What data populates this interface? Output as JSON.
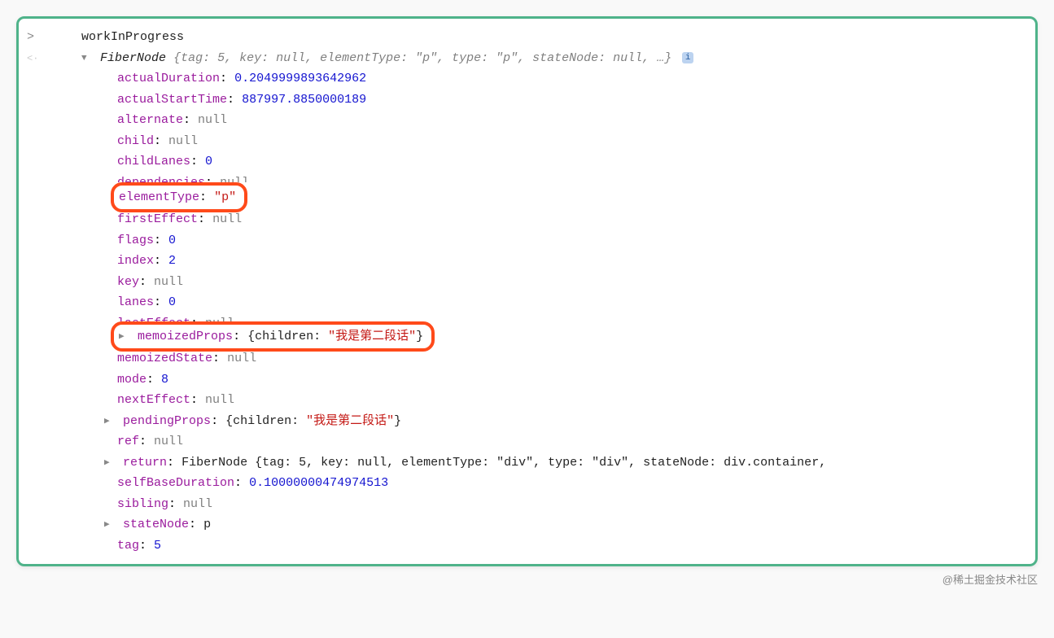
{
  "prompt": "workInProgress",
  "summary": {
    "typeName": "FiberNode",
    "open": "{",
    "inside": "tag: 5, key: null, elementType: \"p\", type: \"p\", stateNode: null, …",
    "close": "}",
    "info": "i"
  },
  "props": {
    "actualDuration_k": "actualDuration",
    "actualDuration_v": "0.2049999893642962",
    "actualStartTime_k": "actualStartTime",
    "actualStartTime_v": "887997.8850000189",
    "alternate_k": "alternate",
    "alternate_v": "null",
    "child_k": "child",
    "child_v": "null",
    "childLanes_k": "childLanes",
    "childLanes_v": "0",
    "dependencies_k": "dependencies",
    "dependencies_v": "null",
    "elementType_k": "elementType",
    "elementType_v": "\"p\"",
    "firstEffect_k": "firstEffect",
    "firstEffect_v": "null",
    "flags_k": "flags",
    "flags_v": "0",
    "index_k": "index",
    "index_v": "2",
    "key_k": "key",
    "key_v": "null",
    "lanes_k": "lanes",
    "lanes_v": "0",
    "lastEffect_k": "lastEffect",
    "lastEffect_v": "null",
    "memoizedProps_k": "memoizedProps",
    "memoizedProps_open": "{children: ",
    "memoizedProps_str": "\"我是第二段话\"",
    "memoizedProps_close": "}",
    "memoizedState_k": "memoizedState",
    "memoizedState_v": "null",
    "mode_k": "mode",
    "mode_v": "8",
    "nextEffect_k": "nextEffect",
    "nextEffect_v": "null",
    "pendingProps_k": "pendingProps",
    "pendingProps_open": "{children: ",
    "pendingProps_str": "\"我是第二段话\"",
    "pendingProps_close": "}",
    "ref_k": "ref",
    "ref_v": "null",
    "return_k": "return",
    "return_v": "FiberNode {tag: 5, key: null, elementType: \"div\", type: \"div\", stateNode: div.container,",
    "selfBaseDuration_k": "selfBaseDuration",
    "selfBaseDuration_v": "0.10000000474974513",
    "sibling_k": "sibling",
    "sibling_v": "null",
    "stateNode_k": "stateNode",
    "stateNode_v": "p",
    "tag_k": "tag",
    "tag_v": "5"
  },
  "watermark": "@稀土掘金技术社区"
}
